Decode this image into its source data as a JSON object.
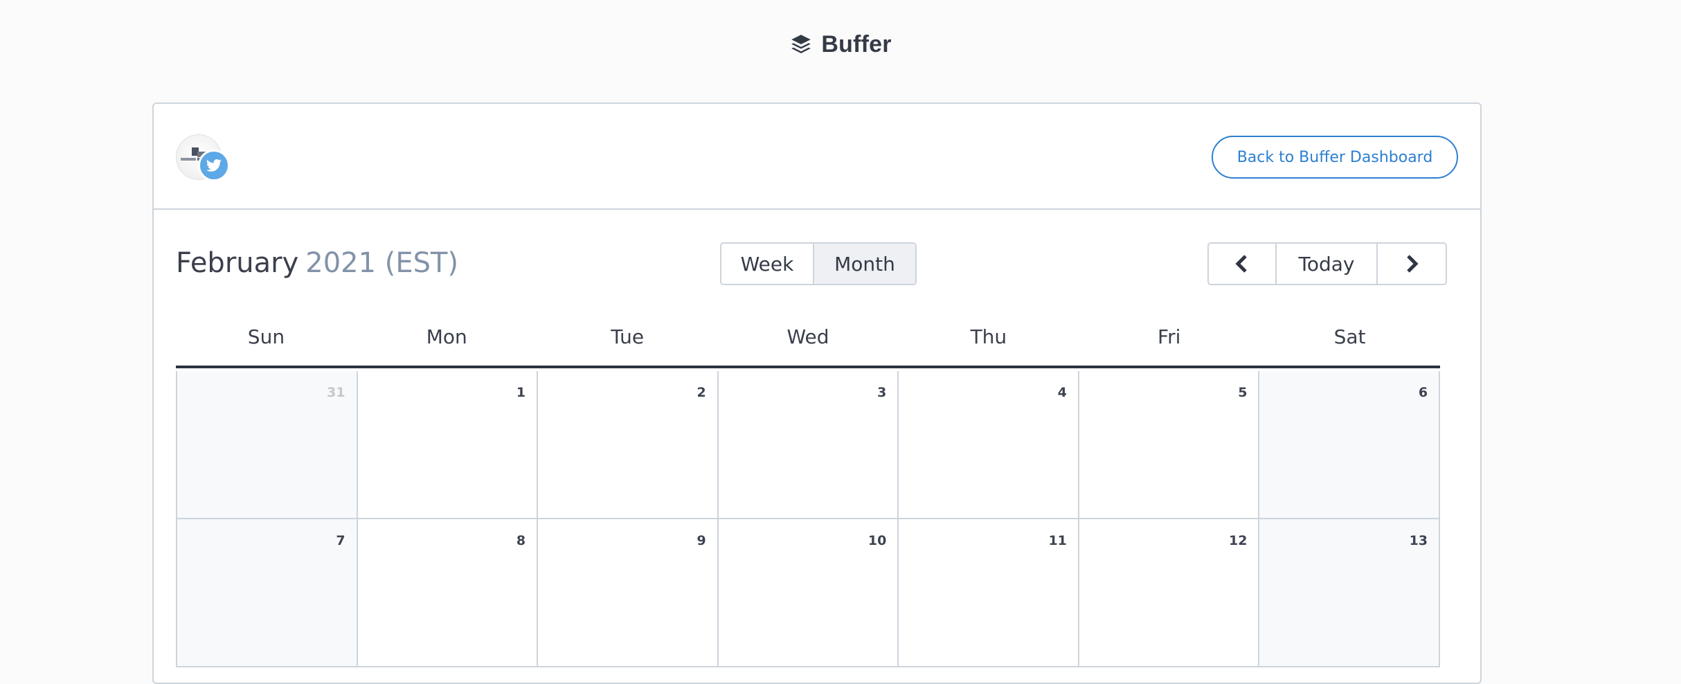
{
  "app": {
    "name": "Buffer",
    "logo_icon": "buffer-layers-icon"
  },
  "header": {
    "profile": {
      "avatar_icon": "profile-avatar",
      "network_icon": "twitter-icon",
      "network_color": "#5da8e6"
    },
    "back_button": "Back to Buffer Dashboard"
  },
  "calendar": {
    "month": "February",
    "year_tz": "2021 (EST)",
    "views": [
      "Week",
      "Month"
    ],
    "active_view": "Month",
    "nav": {
      "prev_icon": "chevron-left-icon",
      "today": "Today",
      "next_icon": "chevron-right-icon"
    },
    "weekdays": [
      "Sun",
      "Mon",
      "Tue",
      "Wed",
      "Thu",
      "Fri",
      "Sat"
    ],
    "weeks": [
      {
        "days": [
          {
            "num": "31",
            "other": true
          },
          {
            "num": "1"
          },
          {
            "num": "2"
          },
          {
            "num": "3"
          },
          {
            "num": "4"
          },
          {
            "num": "5"
          },
          {
            "num": "6"
          }
        ]
      },
      {
        "days": [
          {
            "num": "7"
          },
          {
            "num": "8"
          },
          {
            "num": "9"
          },
          {
            "num": "10"
          },
          {
            "num": "11"
          },
          {
            "num": "12"
          },
          {
            "num": "13"
          }
        ]
      }
    ]
  },
  "colors": {
    "accent": "#2c7fd0",
    "border": "#cdd4dc",
    "weekend_bg": "#f8f9fb",
    "muted_title": "#8292a8"
  }
}
